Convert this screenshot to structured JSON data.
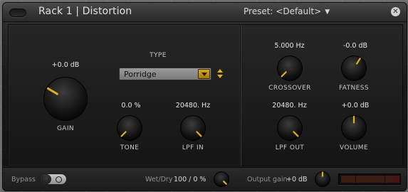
{
  "window": {
    "title": "Rack 1 | Distortion",
    "preset_label": "Preset: <Default>",
    "close_glyph": "✕",
    "accent_color": "#e0b020"
  },
  "controls": {
    "gain": {
      "label": "GAIN",
      "value": "+0.0 dB",
      "level": 0.28
    },
    "type": {
      "label": "TYPE",
      "selected": "Porridge"
    },
    "tone": {
      "label": "TONE",
      "value": "0.0 %",
      "level": 0.0
    },
    "lpf_in": {
      "label": "LPF IN",
      "value": "20480. Hz",
      "level": 1.0
    },
    "crossover": {
      "label": "CROSSOVER",
      "value": "5.000 Hz",
      "level": 0.0
    },
    "fatness": {
      "label": "FATNESS",
      "value": "-0.0 dB",
      "level": 0.62
    },
    "lpf_out": {
      "label": "LPF OUT",
      "value": "20480. Hz",
      "level": 1.0
    },
    "volume": {
      "label": "VOLUME",
      "value": "+0.0 dB",
      "level": 0.5
    }
  },
  "footer": {
    "bypass_label": "Bypass",
    "wet_dry_label": "Wet/Dry",
    "wet_dry_value": "100 / 0 %",
    "wet_dry_level": 1.0,
    "output_gain_label": "Output gain",
    "output_gain_value": "+0 dB",
    "output_gain_level": 0.5
  }
}
